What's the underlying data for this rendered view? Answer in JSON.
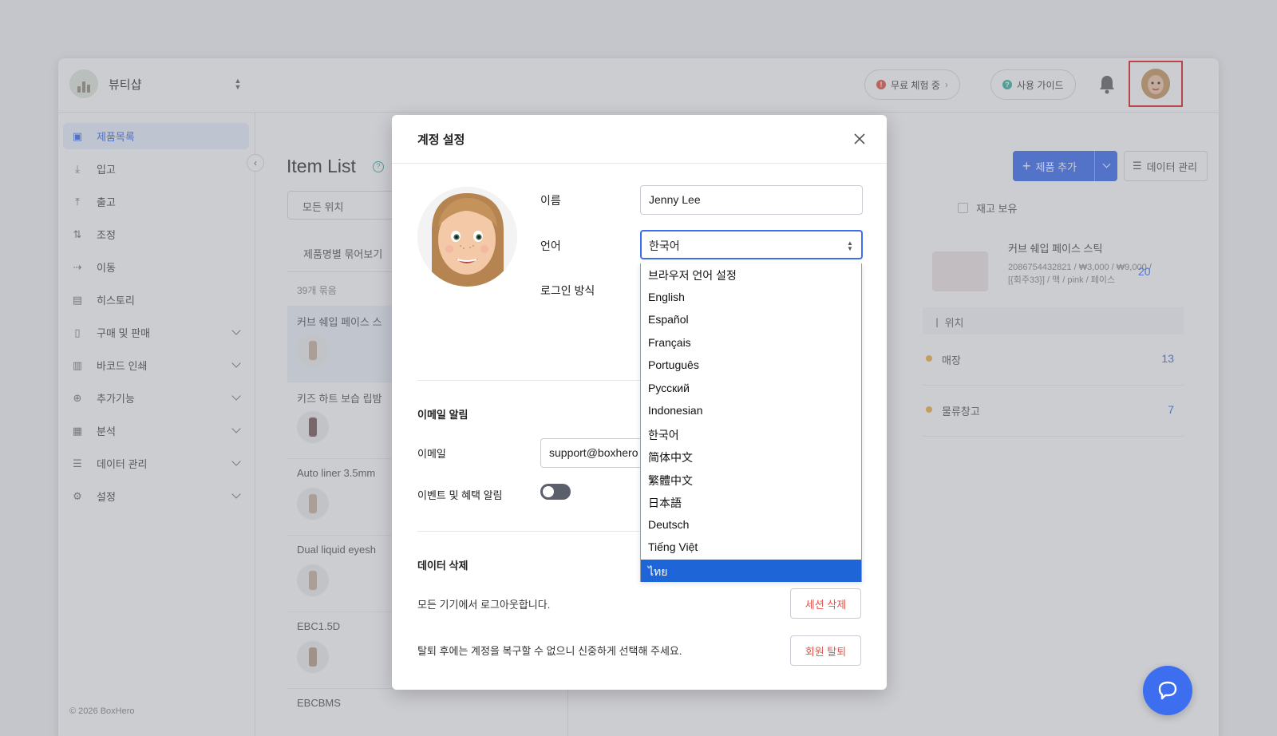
{
  "brand": {
    "name": "뷰티샵"
  },
  "topbar": {
    "trial_label": "무료 체험 중",
    "guide_label": "사용 가이드"
  },
  "sidebar": {
    "items": [
      {
        "label": "제품목록",
        "icon": "box-icon",
        "active": true,
        "expandable": false
      },
      {
        "label": "입고",
        "icon": "arrow-down-icon",
        "active": false,
        "expandable": false
      },
      {
        "label": "출고",
        "icon": "arrow-up-icon",
        "active": false,
        "expandable": false
      },
      {
        "label": "조정",
        "icon": "swap-icon",
        "active": false,
        "expandable": false
      },
      {
        "label": "이동",
        "icon": "move-icon",
        "active": false,
        "expandable": false
      },
      {
        "label": "히스토리",
        "icon": "history-icon",
        "active": false,
        "expandable": false
      },
      {
        "label": "구매 및 판매",
        "icon": "receipt-icon",
        "active": false,
        "expandable": true
      },
      {
        "label": "바코드 인쇄",
        "icon": "barcode-icon",
        "active": false,
        "expandable": true
      },
      {
        "label": "추가기능",
        "icon": "plus-circle-icon",
        "active": false,
        "expandable": true
      },
      {
        "label": "분석",
        "icon": "chart-icon",
        "active": false,
        "expandable": true
      },
      {
        "label": "데이터 관리",
        "icon": "database-icon",
        "active": false,
        "expandable": true
      },
      {
        "label": "설정",
        "icon": "gear-icon",
        "active": false,
        "expandable": true
      }
    ],
    "footer": "© 2026 BoxHero"
  },
  "main": {
    "title": "Item List",
    "location_select": "모든 위치",
    "group_by": "제품명별 묶어보기",
    "group_count": "39개 묶음",
    "add_button": "제품 추가",
    "data_button": "데이터 관리",
    "stock_filter": "재고 보유",
    "items": [
      {
        "name": "커브 쉐입 페이스 스"
      },
      {
        "name": "키즈 하트 보습 립밤"
      },
      {
        "name": "Auto liner 3.5mm"
      },
      {
        "name": "Dual liquid eyesh"
      },
      {
        "name": "EBC1.5D"
      },
      {
        "name": "EBCBMS"
      }
    ],
    "detail": {
      "name": "커브 쉐입 페이스 스틱",
      "meta": "2086754432821 / ₩3,000 / ₩9,000 / [{회주33}] / 맥 / pink / 페이스",
      "qty": "20",
      "locations_header": "ㅣ 위치",
      "locations": [
        {
          "name": "매장",
          "qty": "13"
        },
        {
          "name": "물류창고",
          "qty": "7"
        }
      ]
    }
  },
  "modal": {
    "title": "계정 설정",
    "name_label": "이름",
    "name_value": "Jenny Lee",
    "language_label": "언어",
    "language_value": "한국어",
    "login_label": "로그인 방식",
    "email_section": "이메일 알림",
    "email_label": "이메일",
    "email_value": "support@boxhero",
    "event_label": "이벤트 및 혜택 알림",
    "event_enabled": false,
    "data_section": "데이터 삭제",
    "logout_text": "모든 기기에서 로그아웃합니다.",
    "session_button": "세션 삭제",
    "withdraw_text": "탈퇴 후에는 계정을 복구할 수 없으니 신중하게 선택해 주세요.",
    "withdraw_button": "회원 탈퇴"
  },
  "language_options": [
    "브라우저 언어 설정",
    "English",
    "Español",
    "Français",
    "Português",
    "Русский",
    "Indonesian",
    "한국어",
    "简体中文",
    "繁體中文",
    "日本語",
    "Deutsch",
    "Tiếng Việt",
    "ไทย"
  ],
  "highlighted_option": "ไทย",
  "colors": {
    "accent": "#3d6ef0",
    "danger": "#e5534b",
    "highlight": "#1e66d8",
    "focus_box": "#e0232a"
  }
}
